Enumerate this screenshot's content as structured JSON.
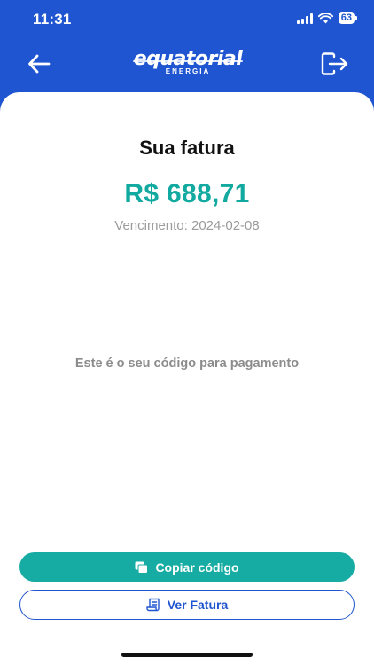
{
  "status_bar": {
    "time": "11:31",
    "battery": "63"
  },
  "header": {
    "logo_word": "equatorial",
    "logo_sub": "ENERGIA",
    "back_icon": "arrow-left-icon",
    "logout_icon": "logout-icon"
  },
  "invoice": {
    "title": "Sua fatura",
    "amount": "R$ 688,71",
    "due": "Vencimento: 2024-02-08",
    "code_caption": "Este é o seu código para pagamento"
  },
  "actions": {
    "copy_label": "Copiar código",
    "view_label": "Ver Fatura"
  },
  "colors": {
    "brand_blue": "#1f55d0",
    "accent_teal": "#17aca3"
  }
}
